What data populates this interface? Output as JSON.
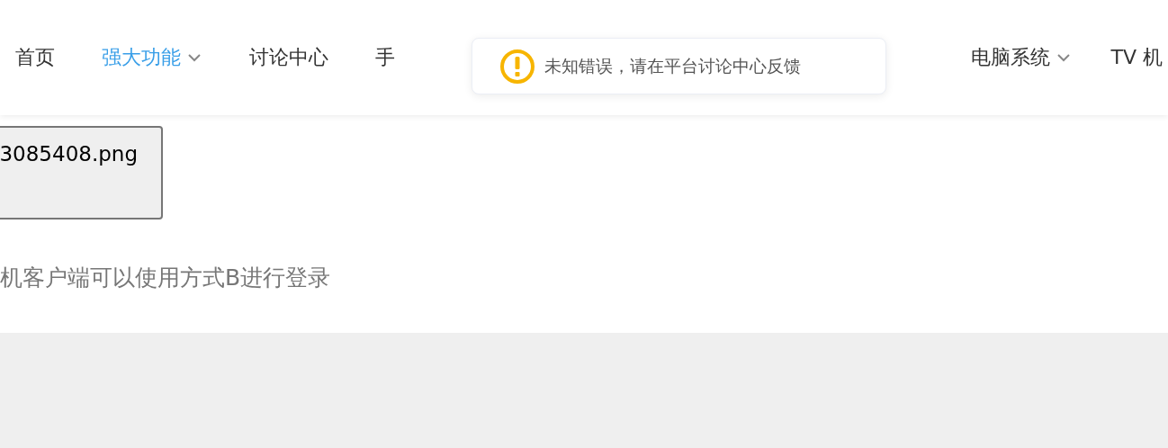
{
  "nav": {
    "items": [
      {
        "label": "首页",
        "selected": false,
        "dropdown": false
      },
      {
        "label": "强大功能",
        "selected": true,
        "dropdown": true
      },
      {
        "label": "讨论中心",
        "selected": false,
        "dropdown": false
      },
      {
        "label": "手",
        "selected": false,
        "dropdown": false
      },
      {
        "label": "电脑系统",
        "selected": false,
        "dropdown": true
      },
      {
        "label": "TV 机",
        "selected": false,
        "dropdown": false
      }
    ]
  },
  "toast": {
    "kind": "warning",
    "message": "未知错误，请在平台讨论中心反馈"
  },
  "file_button": {
    "label": "3085408.png"
  },
  "note": "机客户端可以使用方式B进行登录"
}
